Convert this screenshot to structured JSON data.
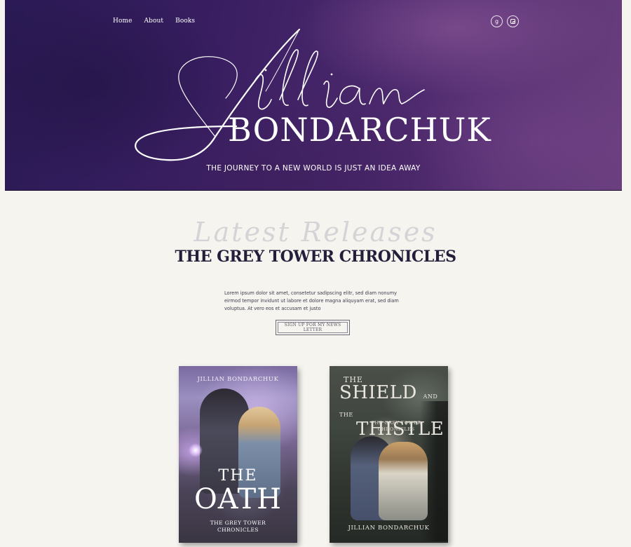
{
  "nav": {
    "items": [
      {
        "label": "Home"
      },
      {
        "label": "About"
      },
      {
        "label": "Books"
      }
    ]
  },
  "social": {
    "goodreads_glyph": "g",
    "icons": [
      "goodreads-icon",
      "instagram-icon"
    ]
  },
  "hero": {
    "script_name": "Jillian",
    "name": "BONDARCHUK",
    "tagline": "THE JOURNEY TO A NEW WORLD IS JUST AN IDEA AWAY"
  },
  "latest": {
    "script_heading": "Latest Releases",
    "series_title": "THE GREY TOWER CHRONICLES",
    "blurb": "Lorem ipsum dolor sit amet, consetetur sadipscing elitr, sed diam nonumy eirmod tempor invidunt ut labore et dolore magna aliquyam erat, sed diam voluptua. At vero eos et accusam et justo",
    "signup_label": "SIGN UP FOR MY NEWS LETTER"
  },
  "books": [
    {
      "author": "JILLIAN BONDARCHUK",
      "title_prefix": "THE",
      "title": "OATH",
      "series_line1": "THE GREY TOWER",
      "series_line2": "CHRONICLES"
    },
    {
      "title_l1": "THE",
      "title_l2": "SHIELD",
      "title_l2_small": "AND THE",
      "title_l3": "THISTLE",
      "series_line1": "THE GREY TOWER",
      "series_line2": "CHRONICLES",
      "author": "JILLIAN BONDARCHUK"
    }
  ],
  "colors": {
    "hero_bg": "#3a1f62",
    "page_bg": "#f6f4ef",
    "title_text": "#231f3b"
  }
}
